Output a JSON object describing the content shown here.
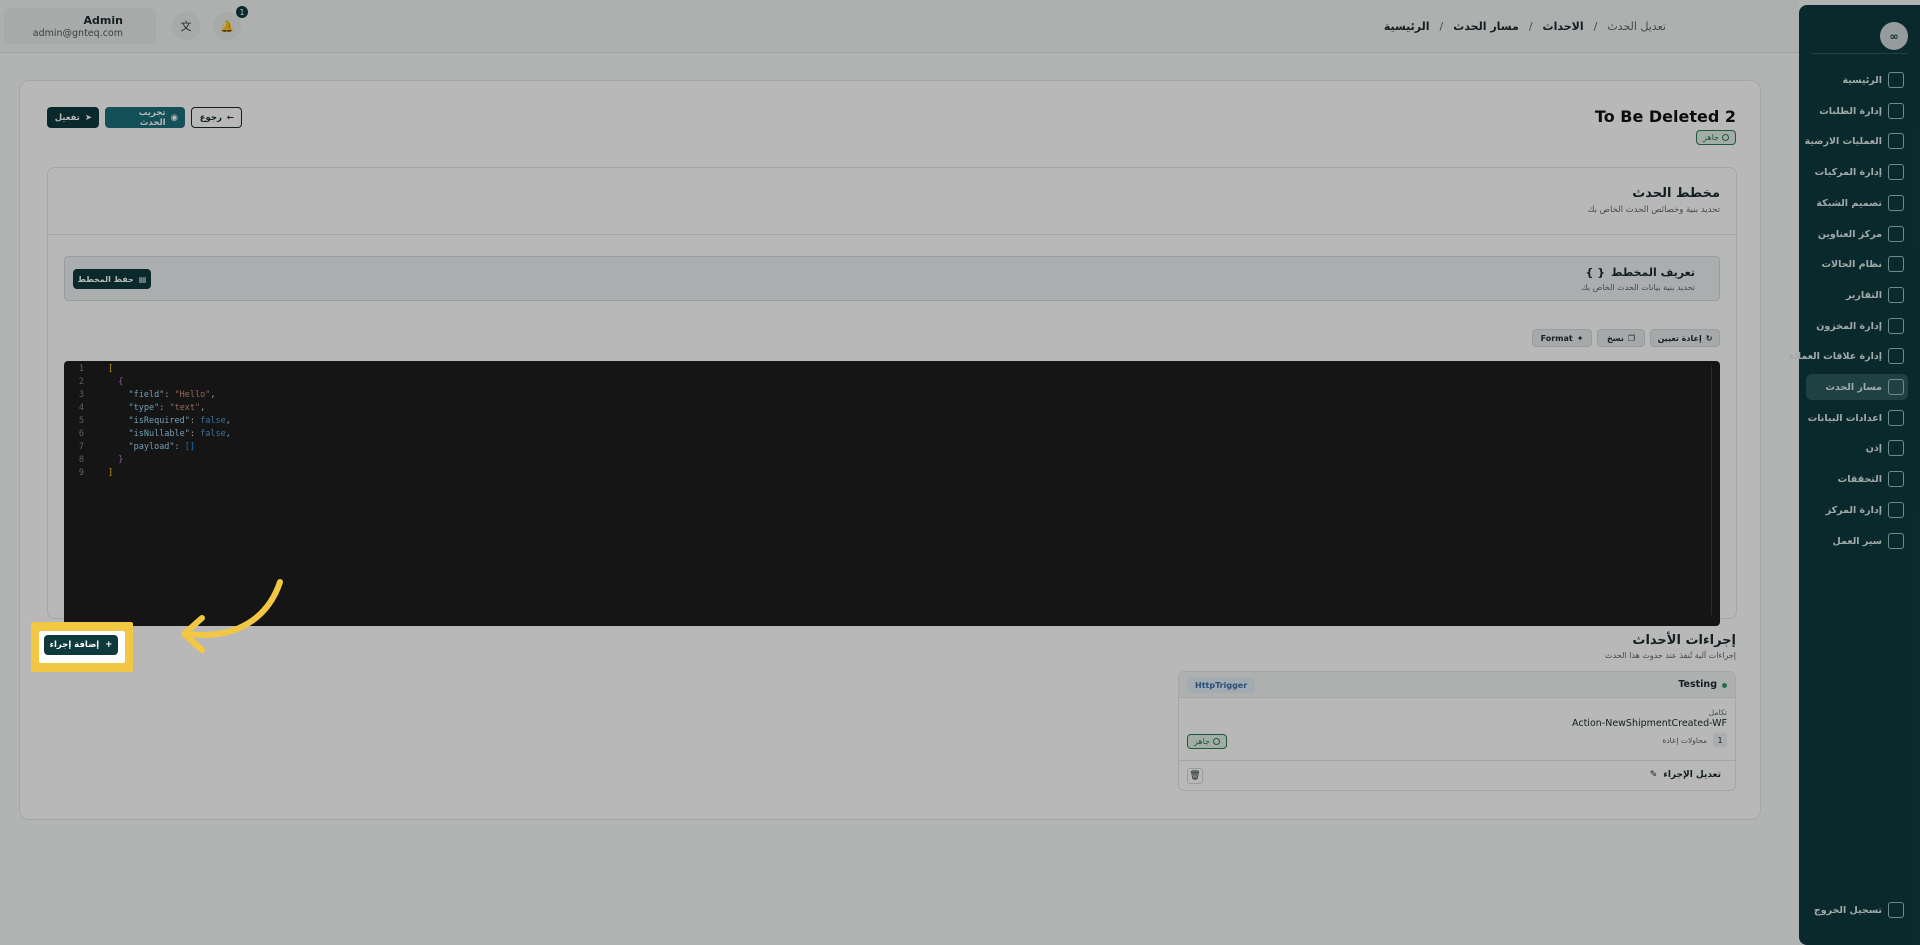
{
  "header": {
    "user_name": "Admin",
    "user_email": "admin@gnteq.com",
    "notification_count": "1",
    "translate_icon": "translate-icon",
    "bell_icon": "bell-icon"
  },
  "breadcrumb": {
    "items": [
      "الرئيسية",
      "مسار الحدث",
      "الاحداث",
      "تعديل الحدث"
    ],
    "separator": "/"
  },
  "sidebar": {
    "logo": "∞",
    "items": [
      {
        "label": "الرئيسية",
        "icon": "dashboard-icon"
      },
      {
        "label": "إدارة الطلبات",
        "icon": "orders-icon"
      },
      {
        "label": "العمليات الارضية",
        "icon": "ground-ops-icon"
      },
      {
        "label": "إدارة المركبات",
        "icon": "truck-icon"
      },
      {
        "label": "تصميم الشبكة",
        "icon": "network-icon"
      },
      {
        "label": "مركز العناوين",
        "icon": "address-icon"
      },
      {
        "label": "نظام الحالات",
        "icon": "status-icon"
      },
      {
        "label": "التقارير",
        "icon": "reports-icon"
      },
      {
        "label": "إدارة المخزون",
        "icon": "inventory-icon"
      },
      {
        "label": "إدارة علاقات العملاء",
        "icon": "crm-icon"
      },
      {
        "label": "مسار الحدث",
        "icon": "event-path-icon"
      },
      {
        "label": "اعدادات البيانات",
        "icon": "database-icon"
      },
      {
        "label": "إذن",
        "icon": "users-icon"
      },
      {
        "label": "التحققات",
        "icon": "tools-icon"
      },
      {
        "label": "إدارة المركز",
        "icon": "center-icon"
      },
      {
        "label": "سير العمل",
        "icon": "workflow-icon"
      }
    ],
    "active_index": 10,
    "logout_label": "تسجيل الخروج"
  },
  "page": {
    "title": "To Be Deleted 2",
    "status": "جاهز",
    "btn_activate": "تفعيل",
    "btn_test": "تجريب الحدث",
    "btn_back": "رجوع"
  },
  "schema": {
    "title": "مخطط الحدث",
    "subtitle": "تحديد بنية وخصائص الحدث الخاص بك",
    "def_title": "تعريف المخطط",
    "def_icon": "{ }",
    "def_subtitle": "تحديد بنية بيانات الحدث الخاص بك",
    "save_label": "حفظ المخطط",
    "btn_reset": "إعادة تعيين",
    "btn_copy": "نسخ",
    "btn_format": "Format"
  },
  "editor": {
    "line_numbers": [
      "1",
      "2",
      "3",
      "4",
      "5",
      "6",
      "7",
      "8",
      "9"
    ]
  },
  "actions": {
    "title": "إجراءات الأحداث",
    "subtitle": "إجراءات آلية تُنفذ عند حدوث هذا الحدث",
    "add_label": "إضافة إجراء",
    "card": {
      "name": "Testing",
      "trigger": "HttpTrigger",
      "integration_label": "تكامل",
      "integration_value": "Action-NewShipmentCreated-WF",
      "retry_count": "1",
      "retry_label": "محاولات إعادة",
      "status": "جاهز",
      "edit_label": "تعديل الإجراء"
    }
  },
  "colors": {
    "sidebar": "#0f3a3d",
    "highlight": "#f2c744",
    "accent": "#1c6f7a"
  }
}
